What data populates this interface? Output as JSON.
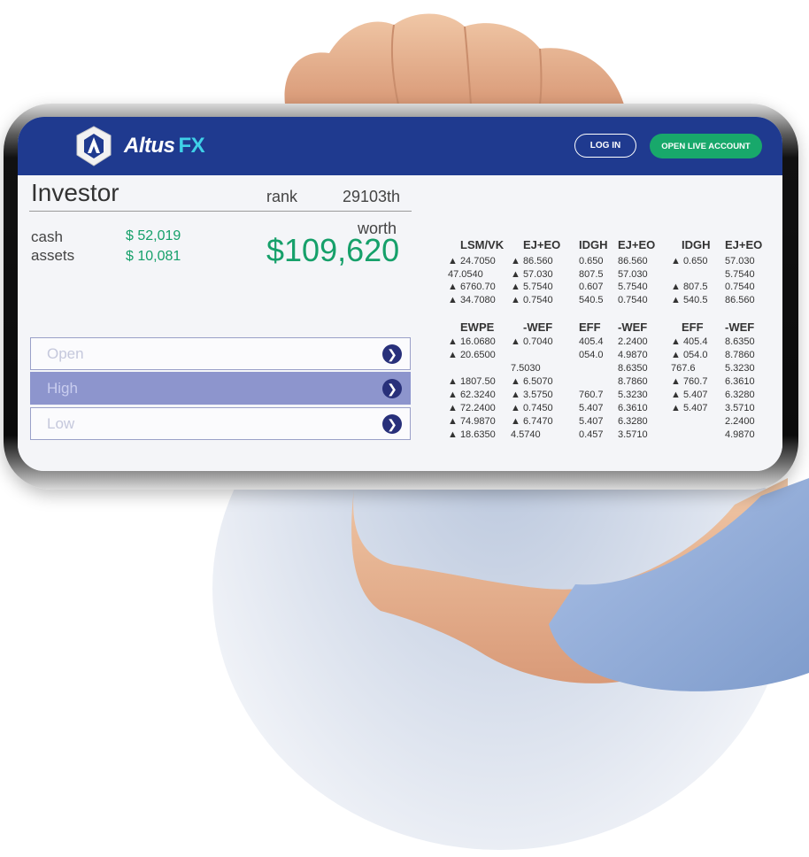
{
  "brand": {
    "name": "Altus",
    "suffix": "FX"
  },
  "header": {
    "login_label": "LOG IN",
    "live_account_label": "OPEN LIVE ACCOUNT"
  },
  "profile": {
    "title": "Investor",
    "rank_label": "rank",
    "rank_value": "29103th",
    "cash_label": "cash",
    "cash_value": "$ 52,019",
    "assets_label": "assets",
    "assets_value": "$ 10,081",
    "worth_label": "worth",
    "worth_value": "$109,620"
  },
  "options": [
    {
      "label": "Open"
    },
    {
      "label": "High"
    },
    {
      "label": "Low"
    }
  ],
  "market": {
    "top_headers": [
      "LSM/VK",
      "EJ+EO",
      "IDGH",
      "EJ+EO",
      "IDGH",
      "EJ+EO"
    ],
    "top_rows": [
      [
        "▲ 24.7050",
        "▲ 86.560",
        "0.650",
        "86.560",
        "▲ 0.650",
        "57.030"
      ],
      [
        "47.0540",
        "▲ 57.030",
        "807.5",
        "57.030",
        "",
        "5.7540"
      ],
      [
        "▲ 6760.70",
        "▲ 5.7540",
        "0.607",
        "5.7540",
        "▲ 807.5",
        "0.7540"
      ],
      [
        "▲ 34.7080",
        "▲ 0.7540",
        "540.5",
        "0.7540",
        "▲ 540.5",
        "86.560"
      ]
    ],
    "bottom_headers": [
      "EWPE",
      "-WEF",
      "EFF",
      "-WEF",
      "EFF",
      "-WEF"
    ],
    "bottom_rows": [
      [
        "▲ 16.0680",
        "▲ 0.7040",
        "405.4",
        "2.2400",
        "▲ 405.4",
        "8.6350"
      ],
      [
        "▲ 20.6500",
        "",
        "054.0",
        "4.9870",
        "▲ 054.0",
        "8.7860"
      ],
      [
        "",
        "7.5030",
        "",
        "8.6350",
        "767.6",
        "5.3230"
      ],
      [
        "▲ 1807.50",
        "▲ 6.5070",
        "",
        "8.7860",
        "▲ 760.7",
        "6.3610"
      ],
      [
        "▲ 62.3240",
        "▲ 3.5750",
        "760.7",
        "5.3230",
        "▲ 5.407",
        "6.3280"
      ],
      [
        "▲ 72.2400",
        "▲ 0.7450",
        "5.407",
        "6.3610",
        "▲ 5.407",
        "3.5710"
      ],
      [
        "▲ 74.9870",
        "▲ 6.7470",
        "5.407",
        "6.3280",
        "",
        "2.2400"
      ],
      [
        "▲ 18.6350",
        "4.5740",
        "0.457",
        "3.5710",
        "",
        "4.9870"
      ]
    ]
  }
}
